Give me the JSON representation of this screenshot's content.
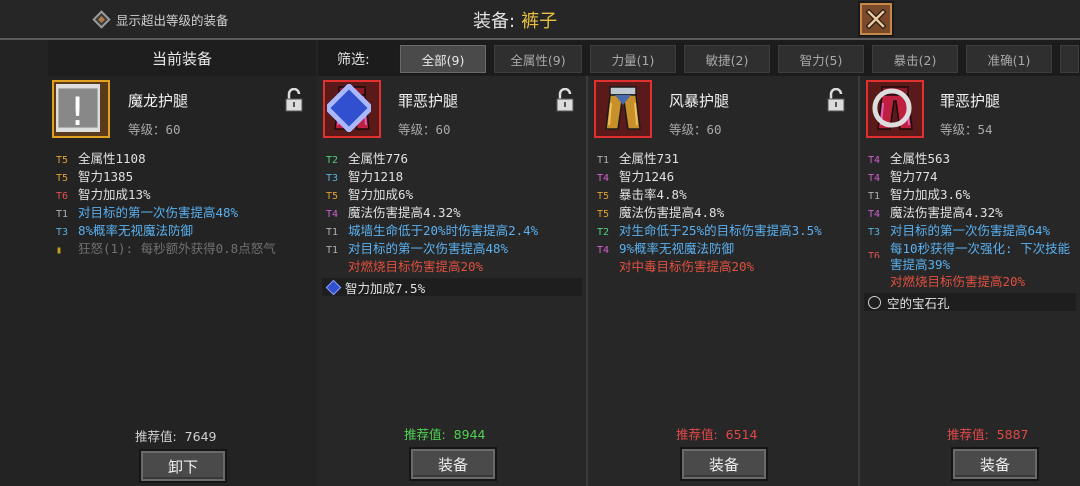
{
  "header": {
    "show_over_level_label": "显示超出等级的装备",
    "title_label": "装备:",
    "title_value": "裤子",
    "close_icon": "close-x-icon"
  },
  "current": {
    "heading": "当前装备",
    "name": "魔龙护腿",
    "level": "等级：60",
    "stats": [
      {
        "tier": "T5",
        "text": "全属性1108",
        "color": "white"
      },
      {
        "tier": "T5",
        "text": "智力1385",
        "color": "white"
      },
      {
        "tier": "T6",
        "text": "智力加成13%",
        "color": "white"
      },
      {
        "tier": "T1",
        "text": "对目标的第一次伤害提高48%",
        "color": "blue"
      },
      {
        "tier": "T3",
        "text": "8%概率无视魔法防御",
        "color": "blue"
      },
      {
        "tier": "",
        "text": "狂怒(1): 每秒额外获得0.8点怒气",
        "color": "gray"
      }
    ],
    "recommend_label": "推荐值:",
    "recommend_value": "7649",
    "action_label": "卸下"
  },
  "filter": {
    "label": "筛选:",
    "tabs": [
      "全部(9)",
      "全属性(9)",
      "力量(1)",
      "敏捷(2)",
      "智力(5)",
      "暴击(2)",
      "准确(1)",
      ""
    ]
  },
  "candidates": [
    {
      "name": "罪恶护腿",
      "level": "等级：60",
      "stats": [
        {
          "tier": "T2",
          "text": "全属性776",
          "color": "white"
        },
        {
          "tier": "T3",
          "text": "智力1218",
          "color": "white"
        },
        {
          "tier": "T5",
          "text": "智力加成6%",
          "color": "white"
        },
        {
          "tier": "T4",
          "text": "魔法伤害提高4.32%",
          "color": "white"
        },
        {
          "tier": "T1",
          "text": "城墙生命低于20%时伤害提高2.4%",
          "color": "blue"
        },
        {
          "tier": "T1",
          "text": "对目标的第一次伤害提高48%",
          "color": "blue"
        },
        {
          "tier": "",
          "text": "对燃烧目标伤害提高20%",
          "color": "red"
        }
      ],
      "gem": "智力加成7.5%",
      "recommend_label": "推荐值:",
      "recommend_value": "8944",
      "action_label": "装备"
    },
    {
      "name": "风暴护腿",
      "level": "等级：60",
      "stats": [
        {
          "tier": "T1",
          "text": "全属性731",
          "color": "white"
        },
        {
          "tier": "T4",
          "text": "智力1246",
          "color": "white"
        },
        {
          "tier": "T5",
          "text": "暴击率4.8%",
          "color": "white"
        },
        {
          "tier": "T5",
          "text": "魔法伤害提高4.8%",
          "color": "white"
        },
        {
          "tier": "T2",
          "text": "对生命低于25%的目标伤害提高3.5%",
          "color": "blue"
        },
        {
          "tier": "T4",
          "text": "9%概率无视魔法防御",
          "color": "blue"
        },
        {
          "tier": "",
          "text": "对中毒目标伤害提高20%",
          "color": "red"
        }
      ],
      "recommend_label": "推荐值:",
      "recommend_value": "6514",
      "action_label": "装备"
    },
    {
      "name": "罪恶护腿",
      "level": "等级：54",
      "stats": [
        {
          "tier": "T4",
          "text": "全属性563",
          "color": "white"
        },
        {
          "tier": "T4",
          "text": "智力774",
          "color": "white"
        },
        {
          "tier": "T1",
          "text": "智力加成3.6%",
          "color": "white"
        },
        {
          "tier": "T4",
          "text": "魔法伤害提高4.32%",
          "color": "white"
        },
        {
          "tier": "T3",
          "text": "对目标的第一次伤害提高64%",
          "color": "blue"
        },
        {
          "tier": "T6",
          "text": "每10秒获得一次强化: 下次技能",
          "color": "blue"
        },
        {
          "tier": "",
          "text": "害提高39%",
          "color": "blue"
        },
        {
          "tier": "",
          "text": "对燃烧目标伤害提高20%",
          "color": "red"
        }
      ],
      "gem": "空的宝石孔",
      "recommend_label": "推荐值:",
      "recommend_value": "5887",
      "action_label": "装备"
    }
  ]
}
